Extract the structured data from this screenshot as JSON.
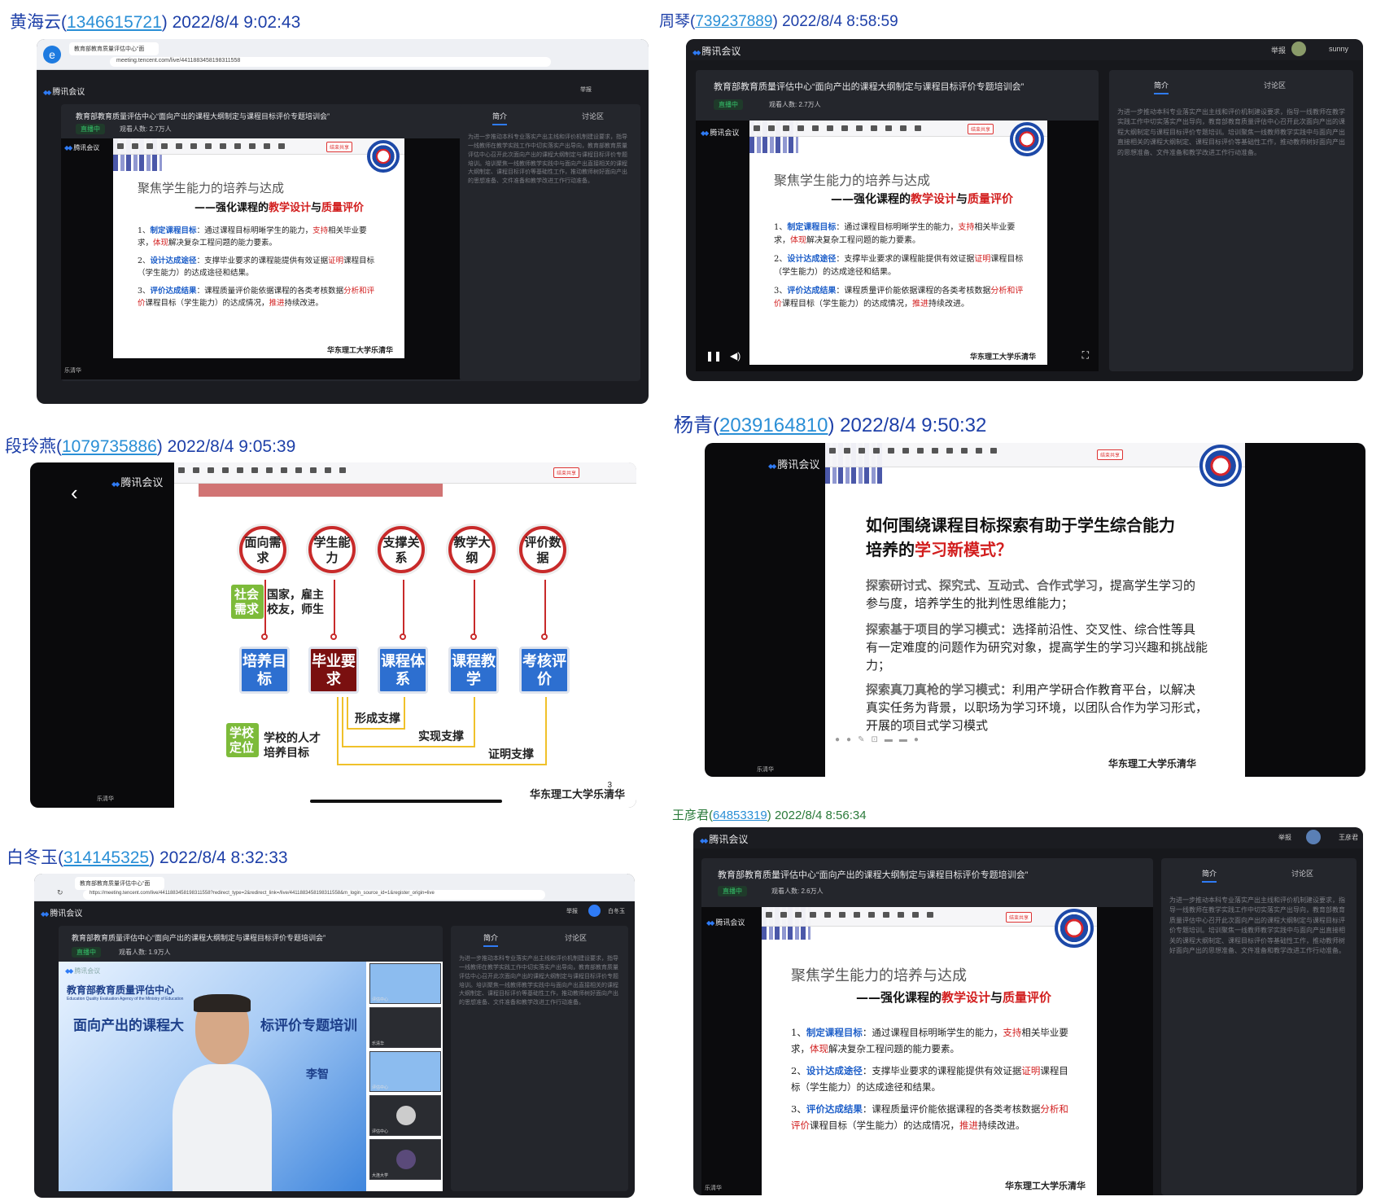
{
  "posts": [
    {
      "name": "黄海云",
      "uid": "1346615721",
      "time": "2022/8/4 9:02:43"
    },
    {
      "name": "周琴",
      "uid": "739237889",
      "time": "2022/8/4 8:58:59"
    },
    {
      "name": "段玲燕",
      "uid": "1079735886",
      "time": "2022/8/4 9:05:39"
    },
    {
      "name": "杨青",
      "uid": "2039164810",
      "time": "2022/8/4 9:50:32"
    },
    {
      "name": "王彦君",
      "uid": "64853319",
      "time": "2022/8/4 8:56:34"
    },
    {
      "name": "白冬玉",
      "uid": "314145325",
      "time": "2022/8/4 8:32:33"
    }
  ],
  "meeting": {
    "app_name": "腾讯会议",
    "event_title": "教育部教育质量评估中心“面向产出的课程大纲制定与课程目标评价专题培训会”",
    "live_label": "直播中",
    "viewers_1": "观看人数: 2.7万人",
    "viewers_5": "观看人数: 2.6万人",
    "viewers_6": "观看人数: 1.9万人",
    "tab_intro": "简介",
    "tab_discussion": "讨论区",
    "report": "举报",
    "user_sunny": "sunny",
    "user_wang": "王彦君",
    "user_bai": "白冬玉",
    "description": "为进一步推动本科专业落实产出主线和评价机制建设要求，指导一线教师在教学实践工作中切实落实产出导向，教育部教育质量评估中心召开此次面向产出的课程大纲制定与课程目标评价专题培训。培训聚焦一线教师教学实践中与面向产出直接相关的课程大纲制定、课程目标评价等基础性工作，推动教师树好面向产出的思想准备、文件准备和教学改进工作行动准备。",
    "presenter": "乐清华",
    "end_share": "结束共享"
  },
  "browser": {
    "tab_title": "教育部教育质量评估中心“面",
    "url_1": "meeting.tencent.com/live/4411883458198311558",
    "url_6": "https://meeting.tencent.com/live/4411883458198311558?redirect_type=2&redirect_link=/live/4411883458198311558&m_login_source_id=1&register_origin=live"
  },
  "slide_focus": {
    "title": "聚焦学生能力的培养与达成",
    "sub_prefix": "——强化课程的",
    "sub_red1": "教学设计",
    "sub_mid": "与",
    "sub_red2": "质量评价",
    "p1_num": "1、",
    "p1_key": "制定课程目标",
    "p1_a": "：通过课程目标明晰学生的能力，",
    "p1_red1": "支持",
    "p1_b": "相关毕业要求，",
    "p1_red2": "体现",
    "p1_c": "解决复杂工程问题的能力要素。",
    "p2_num": "2、",
    "p2_key": "设计达成途径",
    "p2_a": "：支撑毕业要求的课程能提供有效证据",
    "p2_red": "证明",
    "p2_b": "课程目标（学生能力）的达成途径和结果。",
    "p3_num": "3、",
    "p3_key": "评价达成结果",
    "p3_a": "：课程质量评价能依据课程的各类考核数据",
    "p3_red1": "分析和评价",
    "p3_b": "课程目标（学生能力）的达成情况，",
    "p3_red2": "推进",
    "p3_c": "持续改进。",
    "footer": "华东理工大学乐清华"
  },
  "slide_flow": {
    "top": [
      "面向需求",
      "学生能力",
      "支撑关系",
      "教学大纲",
      "评价数据"
    ],
    "boxes": [
      "培养目标",
      "毕业要求",
      "课程体系",
      "课程教学",
      "考核评价"
    ],
    "social_tag": "社会需求",
    "social_note_1": "国家，雇主",
    "social_note_2": "校友，师生",
    "school_tag": "学校定位",
    "school_note_1": "学校的人才",
    "school_note_2": "培养目标",
    "support_1": "形成支撑",
    "support_2": "实现支撑",
    "support_3": "证明支撑",
    "footer": "华东理工大学乐清华",
    "page_no": "3"
  },
  "slide_mode": {
    "q_line1": "如何围绕课程目标探索有助于学生综合能力",
    "q_line2_prefix": "培养的",
    "q_line2_red": "学习新模式",
    "q_line2_suffix": "？",
    "i1_lead": "探索研讨式、探究式、互动式、合作式学习，",
    "i1_text": "提高学生学习的参与度，培养学生的批判性思维能力；",
    "i2_lead": "探索基于项目的学习模式：",
    "i2_text": "选择前沿性、交叉性、综合性等具有一定难度的问题作为研究对象，提高学生的学习兴趣和挑战能力；",
    "i3_lead": "探索真刀真枪的学习模式：",
    "i3_text": "利用产学研合作教育平台，以解决真实任务为背景，以职场为学习环境，以团队合作为学习形式，开展的项目式学习模式",
    "footer": "华东理工大学乐清华"
  },
  "cam_view": {
    "org_name": "教育部教育质量评估中心",
    "org_en": "Education Quality Evaluation Agency of the Ministry of Education",
    "banner_left": "面向产出的课程大",
    "banner_right": "标评价专题培训",
    "speaker": "李智",
    "thumb_labels": [
      "评估中心",
      "乐清华",
      "评估中心",
      "评估中心",
      "大连大学"
    ]
  },
  "colors": {
    "caption": "#1d3fa8",
    "uid": "#2a8fd6",
    "accent": "#2f7bf5",
    "live": "#35c46b",
    "red": "#d21e1e"
  },
  "icons": [
    "browser-logo-icon",
    "refresh-icon",
    "back-icon",
    "tencent-meeting-logo-icon",
    "play-icon",
    "volume-icon",
    "fullscreen-icon",
    "avatar-icon",
    "university-seal-icon"
  ]
}
